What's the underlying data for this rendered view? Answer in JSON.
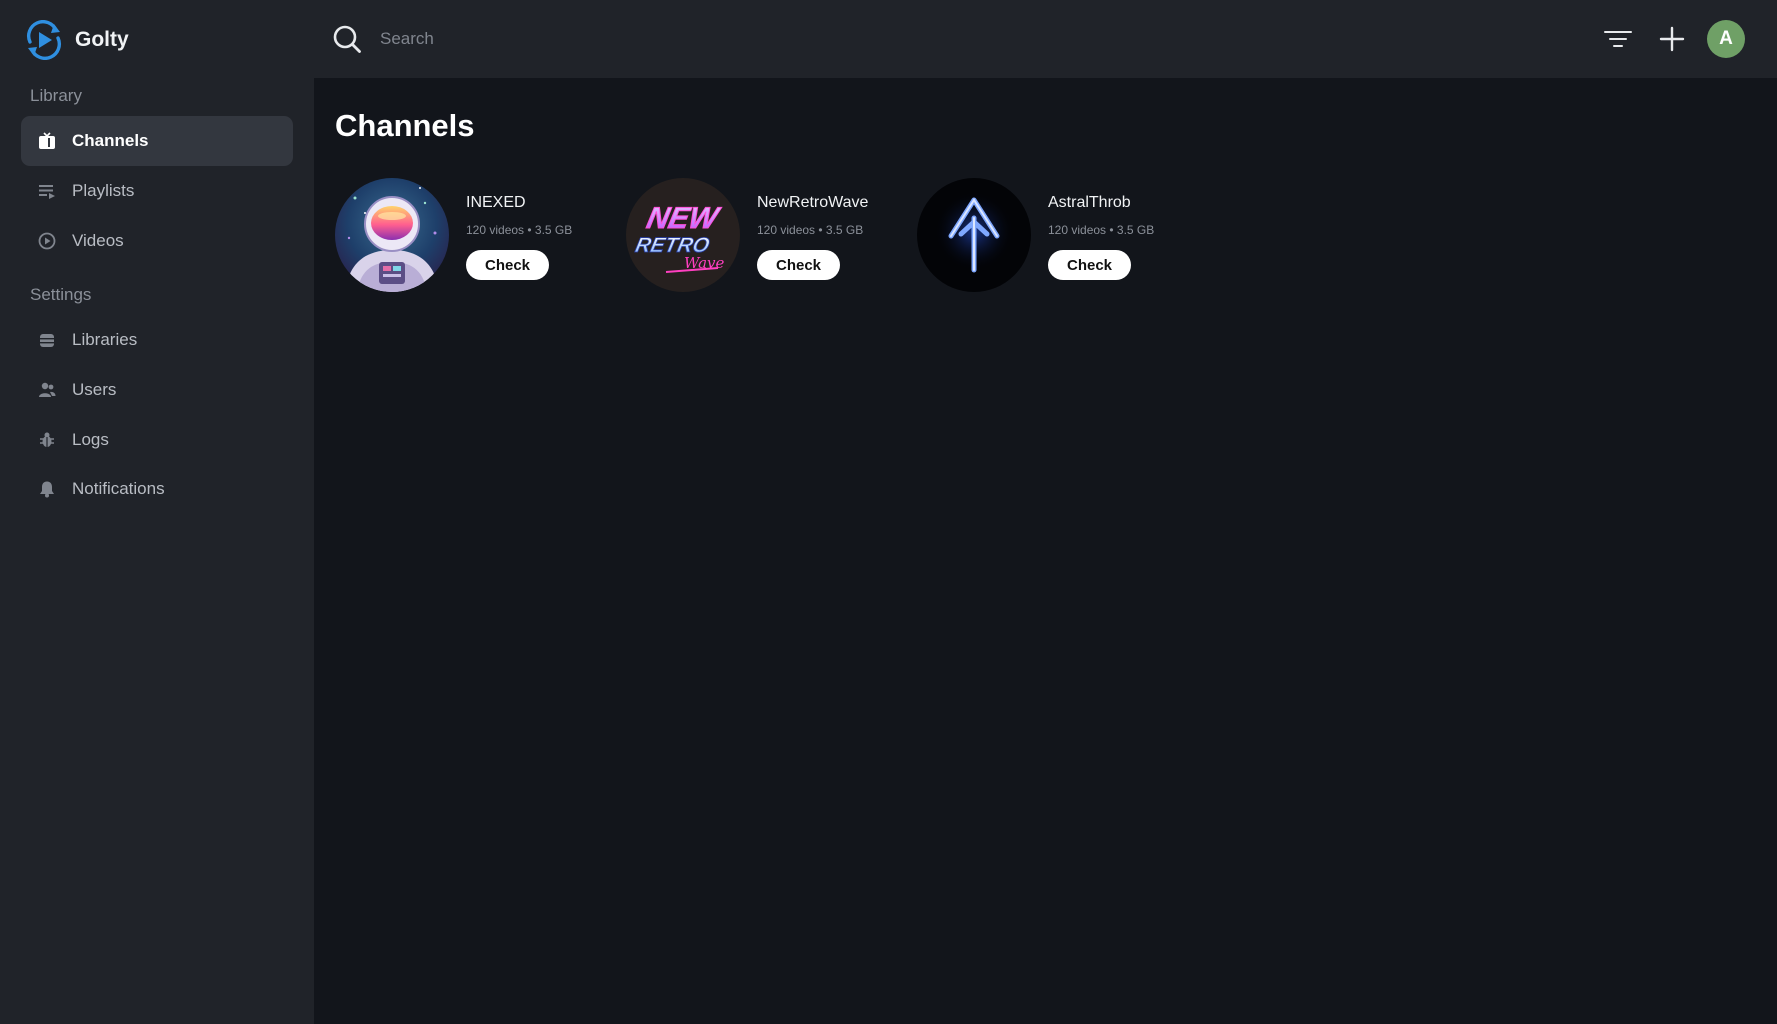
{
  "app": {
    "name": "Golty",
    "logo_icon": "play-sync-logo-icon",
    "accent": "#2f8fe0"
  },
  "sidebar": {
    "sections": [
      {
        "label": "Library"
      },
      {
        "label": "Settings"
      }
    ],
    "items": [
      {
        "label": "Channels",
        "icon": "tv-icon",
        "active": true
      },
      {
        "label": "Playlists",
        "icon": "playlist-icon",
        "active": false
      },
      {
        "label": "Videos",
        "icon": "play-circle-icon",
        "active": false
      },
      {
        "label": "Libraries",
        "icon": "database-icon",
        "active": false
      },
      {
        "label": "Users",
        "icon": "users-icon",
        "active": false
      },
      {
        "label": "Logs",
        "icon": "bug-icon",
        "active": false
      },
      {
        "label": "Notifications",
        "icon": "bell-icon",
        "active": false
      }
    ]
  },
  "topbar": {
    "search_placeholder": "Search",
    "search_value": "",
    "filter_icon": "filter-lines-icon",
    "add_icon": "plus-icon",
    "avatar_letter": "A",
    "avatar_color": "#6fa066"
  },
  "main": {
    "title": "Channels",
    "channels": [
      {
        "name": "INEXED",
        "meta": "120 videos • 3.5 GB",
        "button": "Check",
        "thumb": "astronaut-avatar"
      },
      {
        "name": "NewRetroWave",
        "meta": "120 videos • 3.5 GB",
        "button": "Check",
        "thumb": "new-retro-wave-logo"
      },
      {
        "name": "AstralThrob",
        "meta": "120 videos • 3.5 GB",
        "button": "Check",
        "thumb": "blue-arrow-logo"
      }
    ],
    "thumb_texts": {
      "nrw_line1": "NEW",
      "nrw_line2": "RETRO",
      "nrw_line3": "Wave"
    }
  }
}
